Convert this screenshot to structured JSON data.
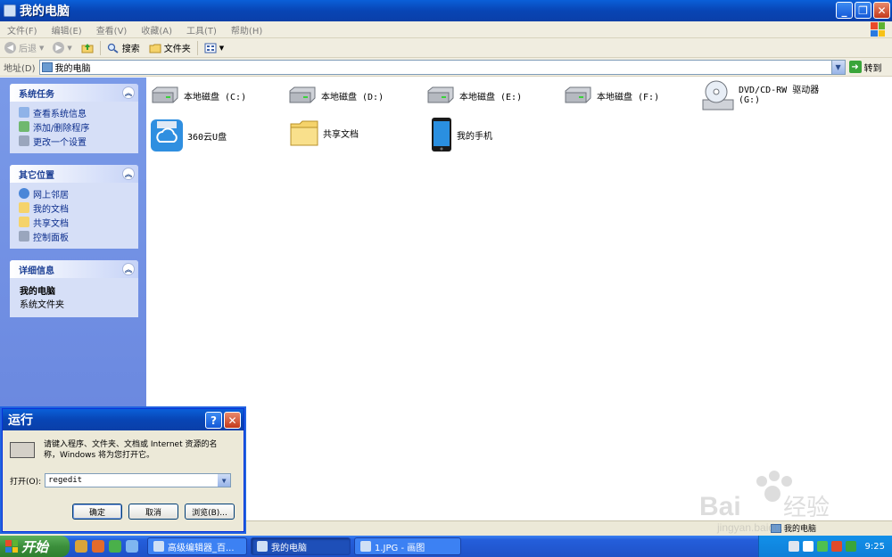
{
  "window": {
    "title": "我的电脑"
  },
  "menu": [
    "文件(F)",
    "编辑(E)",
    "查看(V)",
    "收藏(A)",
    "工具(T)",
    "帮助(H)"
  ],
  "toolbar": {
    "back": "后退",
    "search": "搜索",
    "folders": "文件夹"
  },
  "address": {
    "label": "地址(D)",
    "value": "我的电脑",
    "go": "转到"
  },
  "panels": {
    "system": {
      "title": "系统任务",
      "items": [
        "查看系统信息",
        "添加/删除程序",
        "更改一个设置"
      ]
    },
    "other": {
      "title": "其它位置",
      "items": [
        "网上邻居",
        "我的文档",
        "共享文档",
        "控制面板"
      ]
    },
    "details": {
      "title": "详细信息",
      "name": "我的电脑",
      "type": "系统文件夹"
    }
  },
  "items": {
    "c": "本地磁盘 (C:)",
    "d": "本地磁盘 (D:)",
    "e": "本地磁盘 (E:)",
    "f": "本地磁盘 (F:)",
    "dvd1": "DVD/CD-RW 驱动器",
    "dvd2": "(G:)",
    "usb": "360云U盘",
    "shared": "共享文档",
    "phone": "我的手机"
  },
  "run": {
    "title": "运行",
    "desc": "请键入程序、文件夹、文档或 Internet 资源的名称，Windows 将为您打开它。",
    "open_label": "打开(O):",
    "value": "regedit",
    "ok": "确定",
    "cancel": "取消",
    "browse": "浏览(B)..."
  },
  "status": {
    "text": "我的电脑"
  },
  "taskbar": {
    "start": "开始",
    "tasks": [
      "高级编辑器_百...",
      "我的电脑",
      "1.JPG - 画图"
    ],
    "clock": "9:25"
  },
  "watermark": {
    "text": "Bai经验",
    "url": "jingyan.baidu.com"
  }
}
